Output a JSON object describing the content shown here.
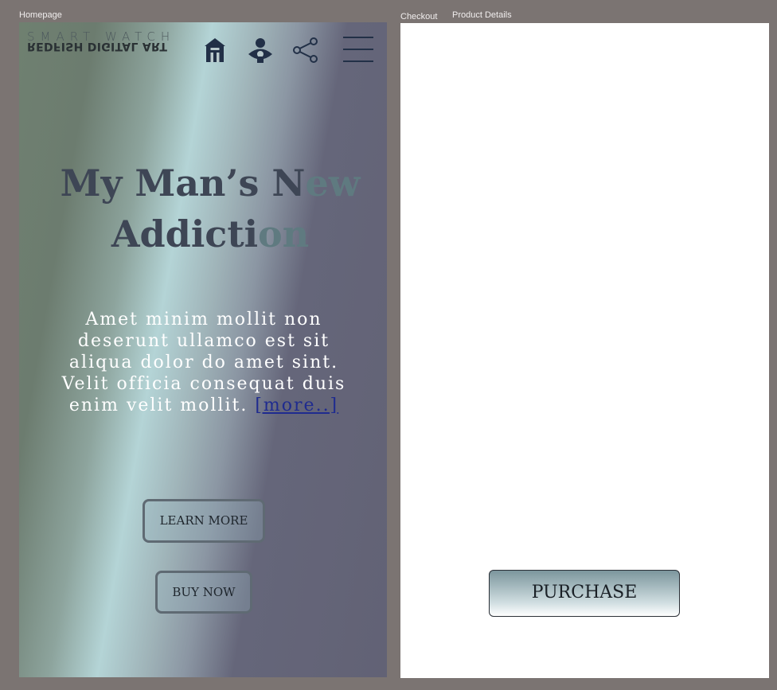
{
  "canvas_labels": {
    "homepage": "Homepage",
    "checkout": "Checkout",
    "product_details": "Product Details"
  },
  "header": {
    "brand_top": "SMART WATCH",
    "brand_bottom": "REDFISH DIGITAL ART",
    "icons": [
      "home-icon",
      "user-icon",
      "share-icon",
      "menu-icon"
    ]
  },
  "hero": {
    "title_line1_a": "My Man’s N",
    "title_line1_b": "ew",
    "title_line2_a": "Addicti",
    "title_line2_b": "on",
    "body": "Amet minim mollit non deserunt ullamco est sit aliqua dolor do amet sint. Velit officia consequat duis enim velit mollit.",
    "more_link": "[more..]"
  },
  "buttons": {
    "learn_more": "LEARN MORE",
    "buy_now": "BUY NOW",
    "purchase": "PURCHASE"
  },
  "colors": {
    "canvas": "#7b7472",
    "text_dark": "#3e4655",
    "link": "#1f2b8f",
    "icon": "#223047"
  }
}
